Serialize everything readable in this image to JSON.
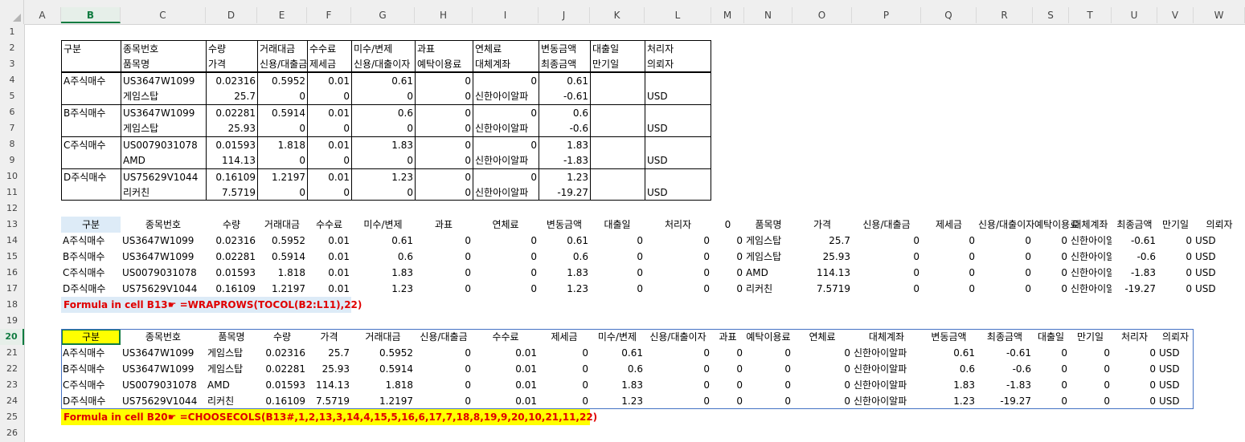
{
  "columns": [
    "A",
    "B",
    "C",
    "D",
    "E",
    "F",
    "G",
    "H",
    "I",
    "J",
    "K",
    "L",
    "M",
    "N",
    "O",
    "P",
    "Q",
    "R",
    "S",
    "T",
    "U",
    "V",
    "W"
  ],
  "selected_column": "B",
  "rows": [
    "1",
    "2",
    "3",
    "4",
    "5",
    "6",
    "7",
    "8",
    "9",
    "10",
    "11",
    "12",
    "13",
    "14",
    "15",
    "16",
    "17",
    "18",
    "19",
    "20",
    "21",
    "22",
    "23",
    "24",
    "25",
    "26"
  ],
  "selected_row": "20",
  "table1": {
    "header_row2": [
      "구분",
      "종목번호",
      "수량",
      "거래대금",
      "수수료",
      "미수/변제",
      "과표",
      "연체료",
      "변동금액",
      "대출일",
      "처리자"
    ],
    "header_row3": [
      "",
      "품목명",
      "가격",
      "신용/대출금",
      "제세금",
      "신용/대출이자",
      "예탁이용료",
      "대체계좌",
      "최종금액",
      "만기일",
      "의뢰자"
    ],
    "rows": [
      [
        "A주식매수",
        "US3647W1099",
        "0.02316",
        "0.5952",
        "0.01",
        "0.61",
        "0",
        "0",
        "0.61",
        "",
        ""
      ],
      [
        "",
        "게임스탑",
        "25.7",
        "0",
        "0",
        "0",
        "0",
        "신한아이알파",
        "-0.61",
        "",
        "USD"
      ],
      [
        "B주식매수",
        "US3647W1099",
        "0.02281",
        "0.5914",
        "0.01",
        "0.6",
        "0",
        "0",
        "0.6",
        "",
        ""
      ],
      [
        "",
        "게임스탑",
        "25.93",
        "0",
        "0",
        "0",
        "0",
        "신한아이알파",
        "-0.6",
        "",
        "USD"
      ],
      [
        "C주식매수",
        "US0079031078",
        "0.01593",
        "1.818",
        "0.01",
        "1.83",
        "0",
        "0",
        "1.83",
        "",
        ""
      ],
      [
        "",
        "AMD",
        "114.13",
        "0",
        "0",
        "0",
        "0",
        "신한아이알파",
        "-1.83",
        "",
        "USD"
      ],
      [
        "D주식매수",
        "US75629V1044",
        "0.16109",
        "1.2197",
        "0.01",
        "1.23",
        "0",
        "0",
        "1.23",
        "",
        ""
      ],
      [
        "",
        "리커친",
        "7.5719",
        "0",
        "0",
        "0",
        "0",
        "신한아이알파",
        "-19.27",
        "",
        "USD"
      ]
    ]
  },
  "table2": {
    "header": [
      "구분",
      "종목번호",
      "수량",
      "거래대금",
      "수수료",
      "미수/변제",
      "과표",
      "연체료",
      "변동금액",
      "대출일",
      "처리자",
      "0",
      "품목명",
      "가격",
      "신용/대출금",
      "제세금",
      "신용/대출이자",
      "예탁이용료",
      "대체계좌",
      "최종금액",
      "만기일",
      "의뢰자"
    ],
    "rows": [
      [
        "A주식매수",
        "US3647W1099",
        "0.02316",
        "0.5952",
        "0.01",
        "0.61",
        "0",
        "0",
        "0.61",
        "0",
        "0",
        "0",
        "게임스탑",
        "25.7",
        "0",
        "0",
        "0",
        "0",
        "신한아이알파",
        "-0.61",
        "0",
        "USD"
      ],
      [
        "B주식매수",
        "US3647W1099",
        "0.02281",
        "0.5914",
        "0.01",
        "0.6",
        "0",
        "0",
        "0.6",
        "0",
        "0",
        "0",
        "게임스탑",
        "25.93",
        "0",
        "0",
        "0",
        "0",
        "신한아이알파",
        "-0.6",
        "0",
        "USD"
      ],
      [
        "C주식매수",
        "US0079031078",
        "0.01593",
        "1.818",
        "0.01",
        "1.83",
        "0",
        "0",
        "1.83",
        "0",
        "0",
        "0",
        "AMD",
        "114.13",
        "0",
        "0",
        "0",
        "0",
        "신한아이알파",
        "-1.83",
        "0",
        "USD"
      ],
      [
        "D주식매수",
        "US75629V1044",
        "0.16109",
        "1.2197",
        "0.01",
        "1.23",
        "0",
        "0",
        "1.23",
        "0",
        "0",
        "0",
        "리커친",
        "7.5719",
        "0",
        "0",
        "0",
        "0",
        "신한아이알파",
        "-19.27",
        "0",
        "USD"
      ]
    ],
    "formula_label": "Formula in cell B13☛ =WRAPROWS(TOCOL(B2:L11),22)"
  },
  "table3": {
    "header": [
      "구분",
      "종목번호",
      "품목명",
      "수량",
      "가격",
      "거래대금",
      "신용/대출금",
      "수수료",
      "제세금",
      "미수/변제",
      "신용/대출이자",
      "과표",
      "예탁이용료",
      "연체료",
      "대체계좌",
      "변동금액",
      "최종금액",
      "대출일",
      "만기일",
      "처리자",
      "의뢰자"
    ],
    "rows": [
      [
        "A주식매수",
        "US3647W1099",
        "게임스탑",
        "0.02316",
        "25.7",
        "0.5952",
        "0",
        "0.01",
        "0",
        "0.61",
        "0",
        "0",
        "0",
        "0",
        "신한아이알파",
        "0.61",
        "-0.61",
        "0",
        "0",
        "0",
        "USD"
      ],
      [
        "B주식매수",
        "US3647W1099",
        "게임스탑",
        "0.02281",
        "25.93",
        "0.5914",
        "0",
        "0.01",
        "0",
        "0.6",
        "0",
        "0",
        "0",
        "0",
        "신한아이알파",
        "0.6",
        "-0.6",
        "0",
        "0",
        "0",
        "USD"
      ],
      [
        "C주식매수",
        "US0079031078",
        "AMD",
        "0.01593",
        "114.13",
        "1.818",
        "0",
        "0.01",
        "0",
        "1.83",
        "0",
        "0",
        "0",
        "0",
        "신한아이알파",
        "1.83",
        "-1.83",
        "0",
        "0",
        "0",
        "USD"
      ],
      [
        "D주식매수",
        "US75629V1044",
        "리커친",
        "0.16109",
        "7.5719",
        "1.2197",
        "0",
        "0.01",
        "0",
        "1.23",
        "0",
        "0",
        "0",
        "0",
        "신한아이알파",
        "1.23",
        "-19.27",
        "0",
        "0",
        "0",
        "USD"
      ]
    ],
    "formula_label": "Formula in cell B20☛ =CHOOSECOLS(B13#,1,2,13,3,14,4,15,5,16,6,17,7,18,8,19,9,20,10,21,11,22)"
  },
  "colors": {
    "header_fill_table2": "#ddebf7",
    "header_fill_table3": "#ffff00",
    "formula_fill_table2": "#ddebf7",
    "formula_fill_table3": "#ffff00",
    "formula_text": "#e00000",
    "selection_accent": "#107c41",
    "spill_border": "#4472c4"
  }
}
